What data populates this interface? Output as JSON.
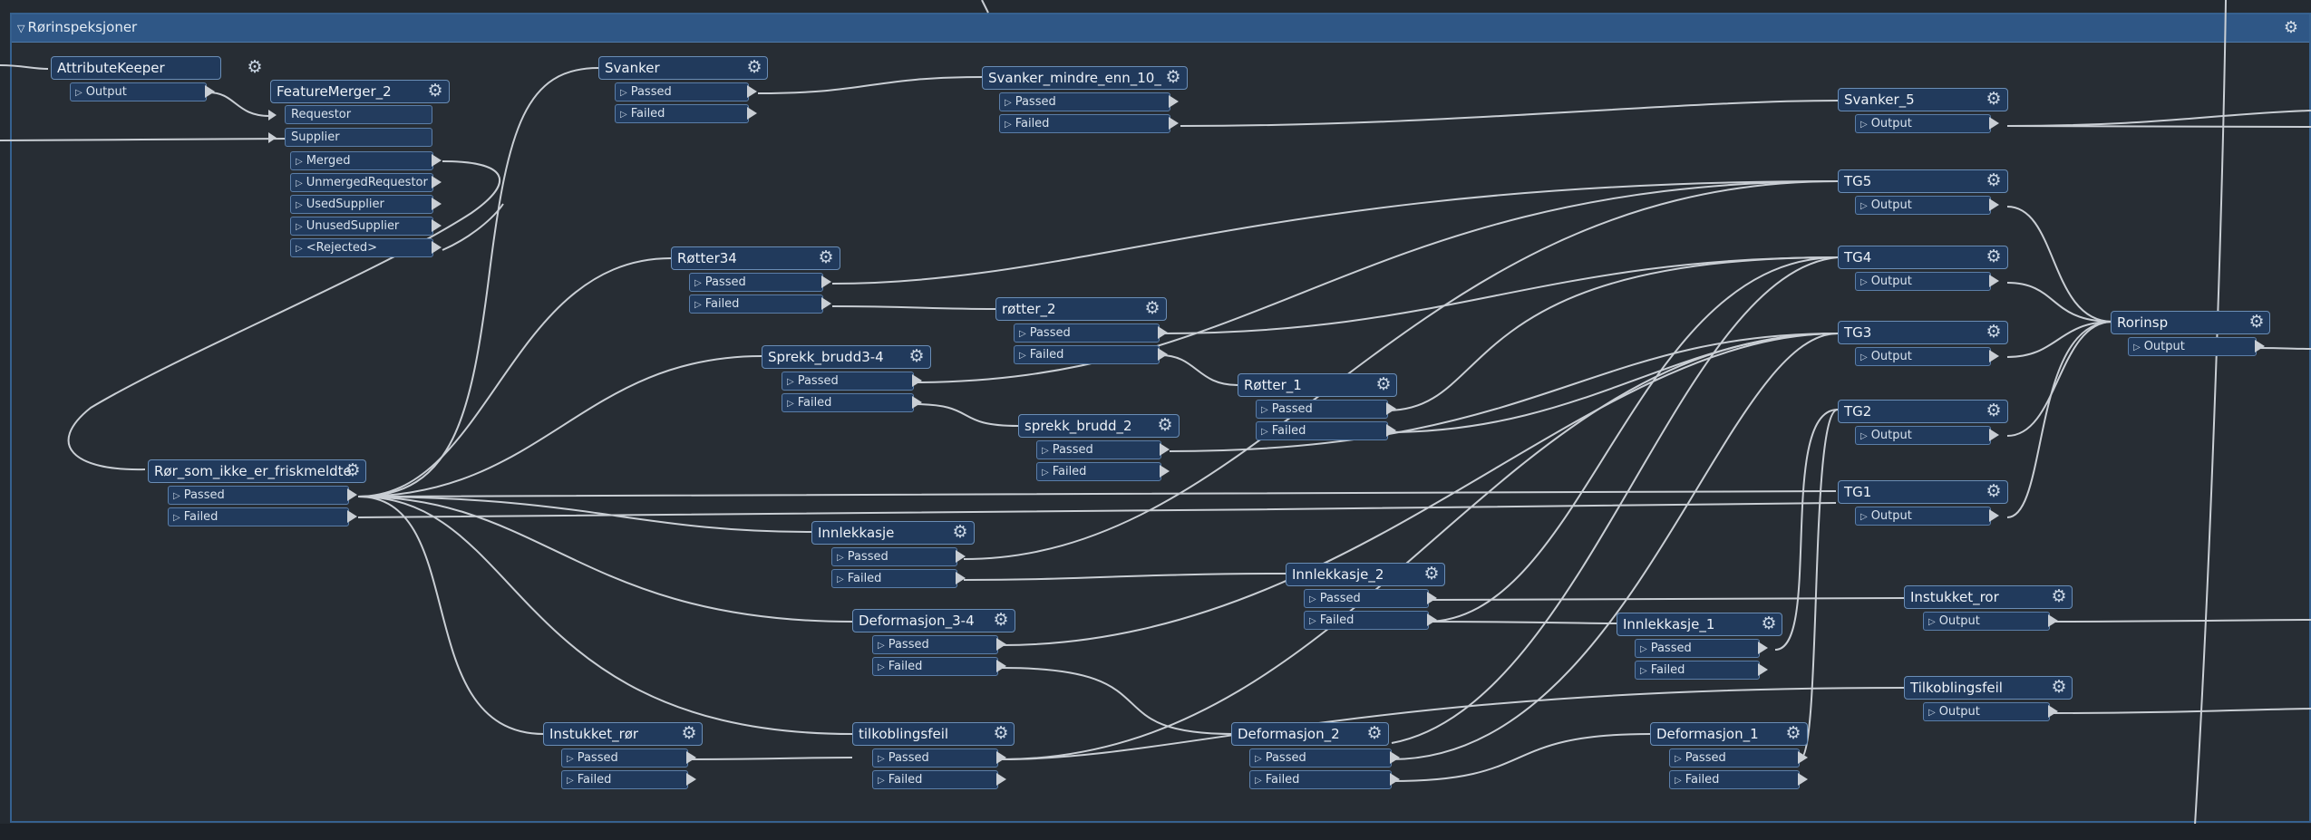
{
  "bookmark": {
    "title": "Rørinspeksjoner",
    "collapse_icon": "triangle-down-icon",
    "settings_icon": "gear-icon"
  },
  "colors": {
    "canvas": "#242a31",
    "bookmark_header": "#2f5786",
    "node": "#213a5c",
    "node_border": "#6a8db5",
    "wire": "#c9ced4"
  },
  "nodes": {
    "attributekeeper": {
      "title": "AttributeKeeper",
      "ports": [
        "Output"
      ]
    },
    "featuremerger_2": {
      "title": "FeatureMerger_2",
      "inputs": [
        "Requestor",
        "Supplier"
      ],
      "ports": [
        "Merged",
        "UnmergedRequestor",
        "UsedSupplier",
        "UnusedSupplier",
        "<Rejected>"
      ]
    },
    "svanker": {
      "title": "Svanker",
      "ports": [
        "Passed",
        "Failed"
      ]
    },
    "svanker_mindre": {
      "title": "Svanker_mindre_enn_10_",
      "ports": [
        "Passed",
        "Failed"
      ]
    },
    "svanker_5": {
      "title": "Svanker_5",
      "ports": [
        "Output"
      ]
    },
    "tg5": {
      "title": "TG5",
      "ports": [
        "Output"
      ]
    },
    "tg4": {
      "title": "TG4",
      "ports": [
        "Output"
      ]
    },
    "tg3": {
      "title": "TG3",
      "ports": [
        "Output"
      ]
    },
    "tg2": {
      "title": "TG2",
      "ports": [
        "Output"
      ]
    },
    "tg1": {
      "title": "TG1",
      "ports": [
        "Output"
      ]
    },
    "rorinsp": {
      "title": "Rorinsp",
      "ports": [
        "Output"
      ]
    },
    "rotter34": {
      "title": "Røtter34",
      "ports": [
        "Passed",
        "Failed"
      ]
    },
    "rotter_2": {
      "title": "røtter_2",
      "ports": [
        "Passed",
        "Failed"
      ]
    },
    "sprekk_brudd3_4": {
      "title": "Sprekk_brudd3-4",
      "ports": [
        "Passed",
        "Failed"
      ]
    },
    "rotter_1": {
      "title": "Røtter_1",
      "ports": [
        "Passed",
        "Failed"
      ]
    },
    "sprekk_brudd_2": {
      "title": "sprekk_brudd_2",
      "ports": [
        "Passed",
        "Failed"
      ]
    },
    "ror_som_ikke": {
      "title": "Rør_som_ikke_er_friskmeldte",
      "ports": [
        "Passed",
        "Failed"
      ]
    },
    "innlekkasje": {
      "title": "Innlekkasje",
      "ports": [
        "Passed",
        "Failed"
      ]
    },
    "innlekkasje_2": {
      "title": "Innlekkasje_2",
      "ports": [
        "Passed",
        "Failed"
      ]
    },
    "instukket_ror_out": {
      "title": "Instukket_ror",
      "ports": [
        "Output"
      ]
    },
    "deformasjon_3_4": {
      "title": "Deformasjon_3-4",
      "ports": [
        "Passed",
        "Failed"
      ]
    },
    "innlekkasje_1": {
      "title": "Innlekkasje_1",
      "ports": [
        "Passed",
        "Failed"
      ]
    },
    "tilkoblingsfeil_out": {
      "title": "Tilkoblingsfeil",
      "ports": [
        "Output"
      ]
    },
    "instukket_ror": {
      "title": "Instukket_rør",
      "ports": [
        "Passed",
        "Failed"
      ]
    },
    "tilkoblingsfeil": {
      "title": "tilkoblingsfeil",
      "ports": [
        "Passed",
        "Failed"
      ]
    },
    "deformasjon_2": {
      "title": "Deformasjon_2",
      "ports": [
        "Passed",
        "Failed"
      ]
    },
    "deformasjon_1": {
      "title": "Deformasjon_1",
      "ports": [
        "Passed",
        "Failed"
      ]
    }
  }
}
